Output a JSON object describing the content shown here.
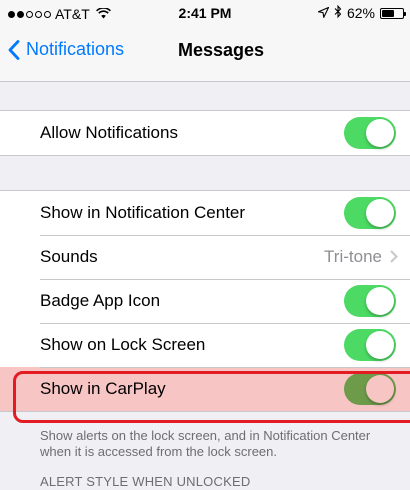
{
  "status_bar": {
    "carrier": "AT&T",
    "signal_bars_filled": 2,
    "signal_bars_total": 5,
    "time": "2:41 PM",
    "battery": "62%",
    "battery_level": 0.62
  },
  "nav": {
    "back_label": "Notifications",
    "title": "Messages"
  },
  "section1": {
    "allow_label": "Allow Notifications",
    "allow_on": true
  },
  "section2": {
    "rows": [
      {
        "label": "Show in Notification Center",
        "on": true
      },
      {
        "label": "Sounds",
        "value": "Tri-tone"
      },
      {
        "label": "Badge App Icon",
        "on": true
      },
      {
        "label": "Show on Lock Screen",
        "on": true
      },
      {
        "label": "Show in CarPlay",
        "on": true
      }
    ]
  },
  "footnote": "Show alerts on the lock screen, and in Notification Center when it is accessed from the lock screen.",
  "alert_style_header": "ALERT STYLE WHEN UNLOCKED",
  "colors": {
    "accent": "#007aff",
    "switch_on": "#4cd964",
    "highlight": "#e31b23"
  }
}
